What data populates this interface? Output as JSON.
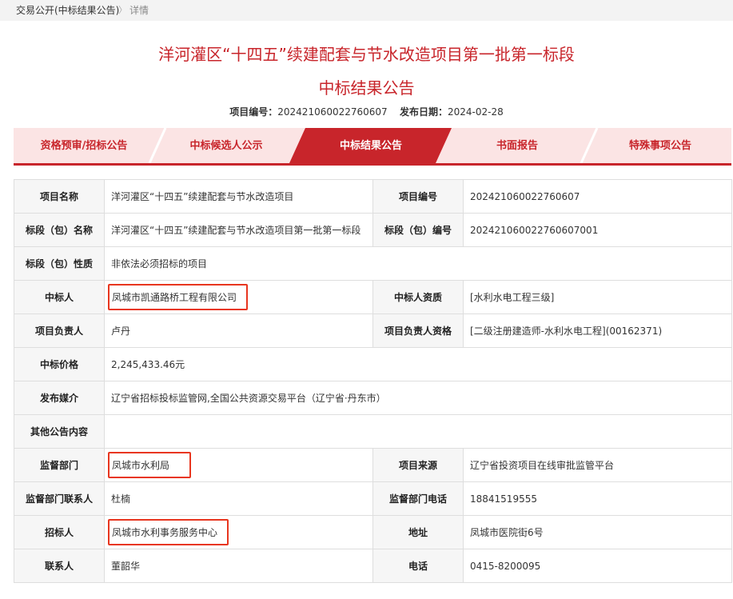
{
  "breadcrumb": {
    "home": "交易公开(中标结果公告)",
    "separator": "〉",
    "current": "详情"
  },
  "title_line1": "洋河灌区“十四五”续建配套与节水改造项目第一批第一标段",
  "title_line2": "中标结果公告",
  "meta": {
    "project_no_label": "项目编号：",
    "project_no": "202421060022760607",
    "publish_date_label": "发布日期：",
    "publish_date": "2024-02-28"
  },
  "tabs": [
    {
      "label": "资格预审/招标公告"
    },
    {
      "label": "中标候选人公示"
    },
    {
      "label": "中标结果公告",
      "active": true
    },
    {
      "label": "书面报告"
    },
    {
      "label": "特殊事项公告"
    }
  ],
  "rows": {
    "r1": {
      "l1": "项目名称",
      "v1": "洋河灌区“十四五”续建配套与节水改造项目",
      "l2": "项目编号",
      "v2": "202421060022760607"
    },
    "r2": {
      "l1": "标段（包）名称",
      "v1": "洋河灌区“十四五”续建配套与节水改造项目第一批第一标段",
      "l2": "标段（包）编号",
      "v2": "202421060022760607001"
    },
    "r3": {
      "l1": "标段（包）性质",
      "v1": "非依法必须招标的项目"
    },
    "r4": {
      "l1": "中标人",
      "v1": "凤城市凯通路桥工程有限公司",
      "l2": "中标人资质",
      "v2": "[水利水电工程三级]"
    },
    "r5": {
      "l1": "项目负责人",
      "v1": "卢丹",
      "l2": "项目负责人资格",
      "v2": "[二级注册建造师-水利水电工程](00162371)"
    },
    "r6": {
      "l1": "中标价格",
      "v1": "2,245,433.46元"
    },
    "r7": {
      "l1": "发布媒介",
      "v1": "辽宁省招标投标监管网,全国公共资源交易平台（辽宁省·丹东市）"
    },
    "r8": {
      "l1": "其他公告内容",
      "v1": ""
    },
    "r9": {
      "l1": "监督部门",
      "v1": "凤城市水利局",
      "l2": "项目来源",
      "v2": "辽宁省投资项目在线审批监管平台"
    },
    "r10": {
      "l1": "监督部门联系人",
      "v1": "杜楠",
      "l2": "监督部门电话",
      "v2": "18841519555"
    },
    "r11": {
      "l1": "招标人",
      "v1": "凤城市水利事务服务中心",
      "l2": "地址",
      "v2": "凤城市医院街6号"
    },
    "r12": {
      "l1": "联系人",
      "v1": "董韶华",
      "l2": "电话",
      "v2": "0415-8200095"
    }
  },
  "colors": {
    "accent": "#c8252b",
    "tab_bg": "#fbe4e4",
    "highlight_box": "#e8361f"
  }
}
